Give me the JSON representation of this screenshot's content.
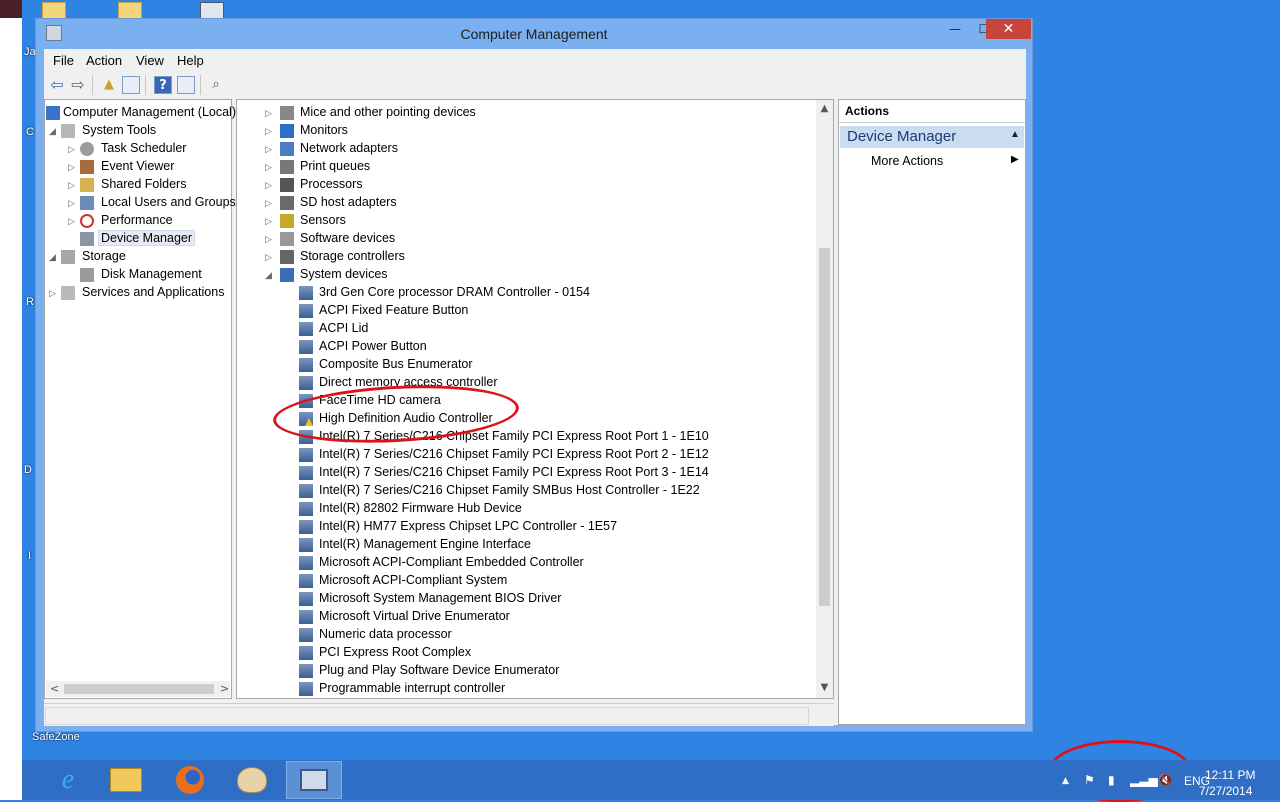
{
  "desktop": {
    "left_labels": [
      "Ja",
      "C",
      "R",
      "D",
      "I"
    ],
    "safezone_label": "SafeZone"
  },
  "window": {
    "title": "Computer Management",
    "minimize": "—",
    "maximize": "☐",
    "close": "✕"
  },
  "menu": [
    "File",
    "Action",
    "View",
    "Help"
  ],
  "tree": [
    {
      "label": "Computer Management (Local)",
      "icon": "computer-icon"
    },
    {
      "label": "System Tools",
      "icon": "tools-icon"
    },
    {
      "label": "Task Scheduler",
      "icon": "clock-icon"
    },
    {
      "label": "Event Viewer",
      "icon": "event-viewer-icon"
    },
    {
      "label": "Shared Folders",
      "icon": "shared-folder-icon"
    },
    {
      "label": "Local Users and Groups",
      "icon": "users-icon"
    },
    {
      "label": "Performance",
      "icon": "performance-icon"
    },
    {
      "label": "Device Manager",
      "icon": "device-manager-icon"
    },
    {
      "label": "Storage",
      "icon": "storage-icon"
    },
    {
      "label": "Disk Management",
      "icon": "disk-icon"
    },
    {
      "label": "Services and Applications",
      "icon": "services-icon"
    }
  ],
  "device_categories": [
    {
      "label": "Mice and other pointing devices",
      "icon": "mouse-icon"
    },
    {
      "label": "Monitors",
      "icon": "monitor-icon"
    },
    {
      "label": "Network adapters",
      "icon": "network-icon"
    },
    {
      "label": "Print queues",
      "icon": "printer-icon"
    },
    {
      "label": "Processors",
      "icon": "processor-icon"
    },
    {
      "label": "SD host adapters",
      "icon": "sd-card-icon"
    },
    {
      "label": "Sensors",
      "icon": "sensor-icon"
    },
    {
      "label": "Software devices",
      "icon": "software-device-icon"
    },
    {
      "label": "Storage controllers",
      "icon": "storage-controller-icon"
    },
    {
      "label": "System devices",
      "icon": "system-devices-icon"
    }
  ],
  "system_devices": [
    {
      "label": "3rd Gen Core processor DRAM Controller - 0154",
      "warning": false
    },
    {
      "label": "ACPI Fixed Feature Button",
      "warning": false
    },
    {
      "label": "ACPI Lid",
      "warning": false
    },
    {
      "label": "ACPI Power Button",
      "warning": false
    },
    {
      "label": "Composite Bus Enumerator",
      "warning": false
    },
    {
      "label": "Direct memory access controller",
      "warning": false
    },
    {
      "label": "FaceTime HD camera",
      "warning": false
    },
    {
      "label": "High Definition Audio Controller",
      "warning": true
    },
    {
      "label": "Intel(R) 7 Series/C216 Chipset Family PCI Express Root Port 1 - 1E10",
      "warning": false
    },
    {
      "label": "Intel(R) 7 Series/C216 Chipset Family PCI Express Root Port 2 - 1E12",
      "warning": false
    },
    {
      "label": "Intel(R) 7 Series/C216 Chipset Family PCI Express Root Port 3 - 1E14",
      "warning": false
    },
    {
      "label": "Intel(R) 7 Series/C216 Chipset Family SMBus Host Controller - 1E22",
      "warning": false
    },
    {
      "label": "Intel(R) 82802 Firmware Hub Device",
      "warning": false
    },
    {
      "label": "Intel(R) HM77 Express Chipset LPC Controller - 1E57",
      "warning": false
    },
    {
      "label": "Intel(R) Management Engine Interface",
      "warning": false
    },
    {
      "label": "Microsoft ACPI-Compliant Embedded Controller",
      "warning": false
    },
    {
      "label": "Microsoft ACPI-Compliant System",
      "warning": false
    },
    {
      "label": "Microsoft System Management BIOS Driver",
      "warning": false
    },
    {
      "label": "Microsoft Virtual Drive Enumerator",
      "warning": false
    },
    {
      "label": "Numeric data processor",
      "warning": false
    },
    {
      "label": "PCI Express Root Complex",
      "warning": false
    },
    {
      "label": "Plug and Play Software Device Enumerator",
      "warning": false
    },
    {
      "label": "Programmable interrupt controller",
      "warning": false
    }
  ],
  "actions": {
    "header": "Actions",
    "section": "Device Manager",
    "more": "More Actions"
  },
  "taskbar": {
    "apps": [
      "internet-explorer-icon",
      "file-explorer-icon",
      "firefox-icon",
      "paint-icon",
      "computer-management-icon"
    ],
    "language": "ENG",
    "time": "12:11 PM",
    "date": "7/27/2014"
  },
  "colors": {
    "desktop": "#2f83e3",
    "window_frame": "#7bb0f0",
    "annotation": "#d9141d",
    "warning": "#f2c200"
  }
}
